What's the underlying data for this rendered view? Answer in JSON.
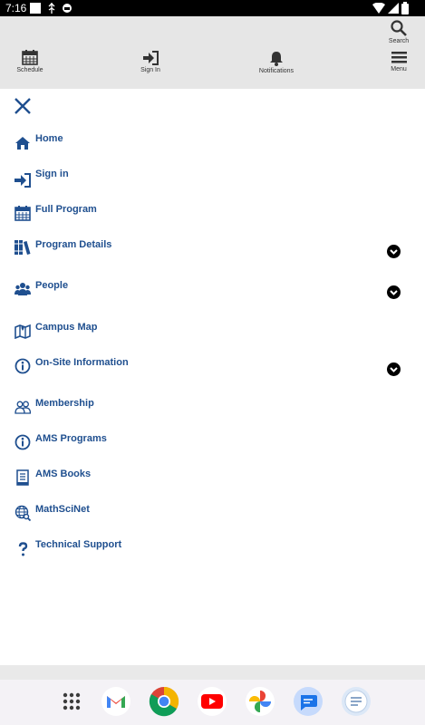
{
  "status_bar": {
    "time": "7:16"
  },
  "toolbar": {
    "schedule": "Schedule",
    "sign_in": "Sign In",
    "notifications": "Notifications",
    "search": "Search",
    "menu": "Menu"
  },
  "menu": {
    "items": [
      {
        "label": "Home",
        "icon": "home-icon"
      },
      {
        "label": "Sign in",
        "icon": "sign-in-icon"
      },
      {
        "label": "Full Program",
        "icon": "calendar-icon"
      },
      {
        "label": "Program Details",
        "icon": "books-icon",
        "expandable": true
      },
      {
        "label": "People",
        "icon": "people-icon",
        "expandable": true
      },
      {
        "label": "Campus Map",
        "icon": "map-icon"
      },
      {
        "label": "On-Site Information",
        "icon": "info-icon",
        "expandable": true
      },
      {
        "label": "Membership",
        "icon": "membership-icon"
      },
      {
        "label": "AMS Programs",
        "icon": "info-icon"
      },
      {
        "label": "AMS Books",
        "icon": "book-icon"
      },
      {
        "label": "MathSciNet",
        "icon": "globe-search-icon"
      },
      {
        "label": "Technical Support",
        "icon": "question-icon"
      }
    ]
  },
  "colors": {
    "accent": "#1f4f8f",
    "toolbar_bg": "#e6e6e6",
    "status_bar_bg": "#000000"
  },
  "dock": {
    "apps": [
      "app-drawer-icon",
      "gmail-icon",
      "chrome-icon",
      "youtube-icon",
      "photos-icon",
      "messages-icon",
      "conference-app-icon"
    ]
  }
}
